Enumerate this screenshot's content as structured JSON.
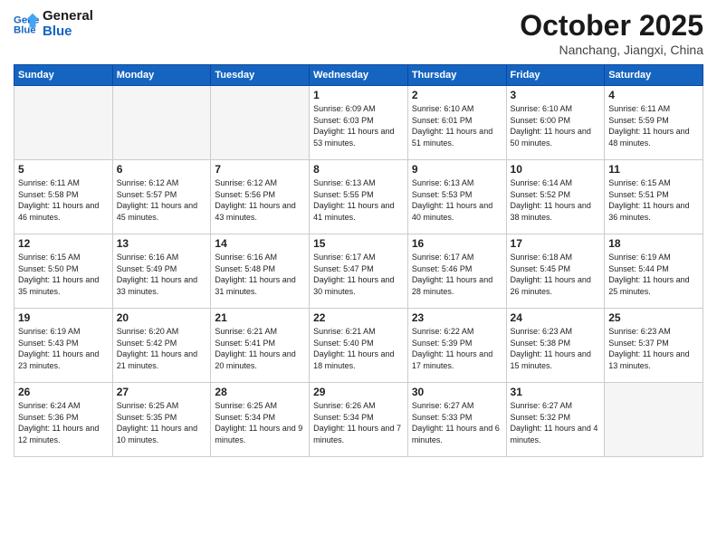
{
  "header": {
    "logo_line1": "General",
    "logo_line2": "Blue",
    "month": "October 2025",
    "location": "Nanchang, Jiangxi, China"
  },
  "days_of_week": [
    "Sunday",
    "Monday",
    "Tuesday",
    "Wednesday",
    "Thursday",
    "Friday",
    "Saturday"
  ],
  "weeks": [
    [
      {
        "day": "",
        "empty": true
      },
      {
        "day": "",
        "empty": true
      },
      {
        "day": "",
        "empty": true
      },
      {
        "day": "1",
        "sunrise": "6:09 AM",
        "sunset": "6:03 PM",
        "daylight": "11 hours and 53 minutes."
      },
      {
        "day": "2",
        "sunrise": "6:10 AM",
        "sunset": "6:01 PM",
        "daylight": "11 hours and 51 minutes."
      },
      {
        "day": "3",
        "sunrise": "6:10 AM",
        "sunset": "6:00 PM",
        "daylight": "11 hours and 50 minutes."
      },
      {
        "day": "4",
        "sunrise": "6:11 AM",
        "sunset": "5:59 PM",
        "daylight": "11 hours and 48 minutes."
      }
    ],
    [
      {
        "day": "5",
        "sunrise": "6:11 AM",
        "sunset": "5:58 PM",
        "daylight": "11 hours and 46 minutes."
      },
      {
        "day": "6",
        "sunrise": "6:12 AM",
        "sunset": "5:57 PM",
        "daylight": "11 hours and 45 minutes."
      },
      {
        "day": "7",
        "sunrise": "6:12 AM",
        "sunset": "5:56 PM",
        "daylight": "11 hours and 43 minutes."
      },
      {
        "day": "8",
        "sunrise": "6:13 AM",
        "sunset": "5:55 PM",
        "daylight": "11 hours and 41 minutes."
      },
      {
        "day": "9",
        "sunrise": "6:13 AM",
        "sunset": "5:53 PM",
        "daylight": "11 hours and 40 minutes."
      },
      {
        "day": "10",
        "sunrise": "6:14 AM",
        "sunset": "5:52 PM",
        "daylight": "11 hours and 38 minutes."
      },
      {
        "day": "11",
        "sunrise": "6:15 AM",
        "sunset": "5:51 PM",
        "daylight": "11 hours and 36 minutes."
      }
    ],
    [
      {
        "day": "12",
        "sunrise": "6:15 AM",
        "sunset": "5:50 PM",
        "daylight": "11 hours and 35 minutes."
      },
      {
        "day": "13",
        "sunrise": "6:16 AM",
        "sunset": "5:49 PM",
        "daylight": "11 hours and 33 minutes."
      },
      {
        "day": "14",
        "sunrise": "6:16 AM",
        "sunset": "5:48 PM",
        "daylight": "11 hours and 31 minutes."
      },
      {
        "day": "15",
        "sunrise": "6:17 AM",
        "sunset": "5:47 PM",
        "daylight": "11 hours and 30 minutes."
      },
      {
        "day": "16",
        "sunrise": "6:17 AM",
        "sunset": "5:46 PM",
        "daylight": "11 hours and 28 minutes."
      },
      {
        "day": "17",
        "sunrise": "6:18 AM",
        "sunset": "5:45 PM",
        "daylight": "11 hours and 26 minutes."
      },
      {
        "day": "18",
        "sunrise": "6:19 AM",
        "sunset": "5:44 PM",
        "daylight": "11 hours and 25 minutes."
      }
    ],
    [
      {
        "day": "19",
        "sunrise": "6:19 AM",
        "sunset": "5:43 PM",
        "daylight": "11 hours and 23 minutes."
      },
      {
        "day": "20",
        "sunrise": "6:20 AM",
        "sunset": "5:42 PM",
        "daylight": "11 hours and 21 minutes."
      },
      {
        "day": "21",
        "sunrise": "6:21 AM",
        "sunset": "5:41 PM",
        "daylight": "11 hours and 20 minutes."
      },
      {
        "day": "22",
        "sunrise": "6:21 AM",
        "sunset": "5:40 PM",
        "daylight": "11 hours and 18 minutes."
      },
      {
        "day": "23",
        "sunrise": "6:22 AM",
        "sunset": "5:39 PM",
        "daylight": "11 hours and 17 minutes."
      },
      {
        "day": "24",
        "sunrise": "6:23 AM",
        "sunset": "5:38 PM",
        "daylight": "11 hours and 15 minutes."
      },
      {
        "day": "25",
        "sunrise": "6:23 AM",
        "sunset": "5:37 PM",
        "daylight": "11 hours and 13 minutes."
      }
    ],
    [
      {
        "day": "26",
        "sunrise": "6:24 AM",
        "sunset": "5:36 PM",
        "daylight": "11 hours and 12 minutes."
      },
      {
        "day": "27",
        "sunrise": "6:25 AM",
        "sunset": "5:35 PM",
        "daylight": "11 hours and 10 minutes."
      },
      {
        "day": "28",
        "sunrise": "6:25 AM",
        "sunset": "5:34 PM",
        "daylight": "11 hours and 9 minutes."
      },
      {
        "day": "29",
        "sunrise": "6:26 AM",
        "sunset": "5:34 PM",
        "daylight": "11 hours and 7 minutes."
      },
      {
        "day": "30",
        "sunrise": "6:27 AM",
        "sunset": "5:33 PM",
        "daylight": "11 hours and 6 minutes."
      },
      {
        "day": "31",
        "sunrise": "6:27 AM",
        "sunset": "5:32 PM",
        "daylight": "11 hours and 4 minutes."
      },
      {
        "day": "",
        "empty": true
      }
    ]
  ]
}
